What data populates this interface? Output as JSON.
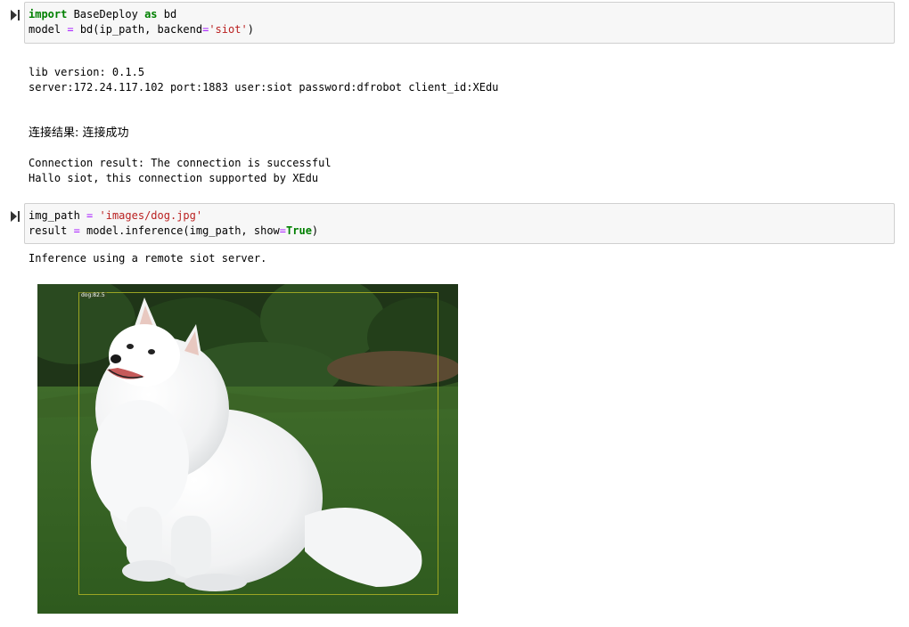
{
  "cells": [
    {
      "lines": [
        [
          {
            "t": "import",
            "c": "kw"
          },
          {
            "t": " BaseDeploy ",
            "c": ""
          },
          {
            "t": "as",
            "c": "kw"
          },
          {
            "t": " bd",
            "c": ""
          }
        ],
        [
          {
            "t": "model ",
            "c": ""
          },
          {
            "t": "=",
            "c": "op"
          },
          {
            "t": " bd(ip_path, backend",
            "c": ""
          },
          {
            "t": "=",
            "c": "op"
          },
          {
            "t": "'siot'",
            "c": "str"
          },
          {
            "t": ")",
            "c": ""
          }
        ]
      ]
    },
    {
      "lines": [
        [
          {
            "t": "img_path ",
            "c": ""
          },
          {
            "t": "=",
            "c": "op"
          },
          {
            "t": " ",
            "c": ""
          },
          {
            "t": "'images/dog.jpg'",
            "c": "str"
          }
        ],
        [
          {
            "t": "result ",
            "c": ""
          },
          {
            "t": "=",
            "c": "op"
          },
          {
            "t": " model.inference(img_path, show",
            "c": ""
          },
          {
            "t": "=",
            "c": "op"
          },
          {
            "t": "True",
            "c": "kw"
          },
          {
            "t": ")",
            "c": ""
          }
        ]
      ]
    }
  ],
  "outputs": {
    "cell1": {
      "lib_version": "lib version: 0.1.5",
      "server_info": "server:172.24.117.102 port:1883 user:siot password:dfrobot client_id:XEdu",
      "connect_cn": "连接结果: 连接成功",
      "connect_en": "Connection result: The connection is successful",
      "hallo": "Hallo siot, this connection supported by XEdu"
    },
    "cell2": {
      "inference_msg": "Inference using a remote siot server.",
      "image": {
        "alt": "Detected white Samoyed dog sitting on grass",
        "bbox_label": "dog:82.5",
        "bbox_color": "#9aa523"
      }
    }
  },
  "colors": {
    "keyword": "#008000",
    "operator": "#aa22ff",
    "string": "#ba2121",
    "cell_bg": "#f7f7f7",
    "cell_border": "#cfcfcf"
  },
  "icons": {
    "run": "run-cell-icon"
  }
}
